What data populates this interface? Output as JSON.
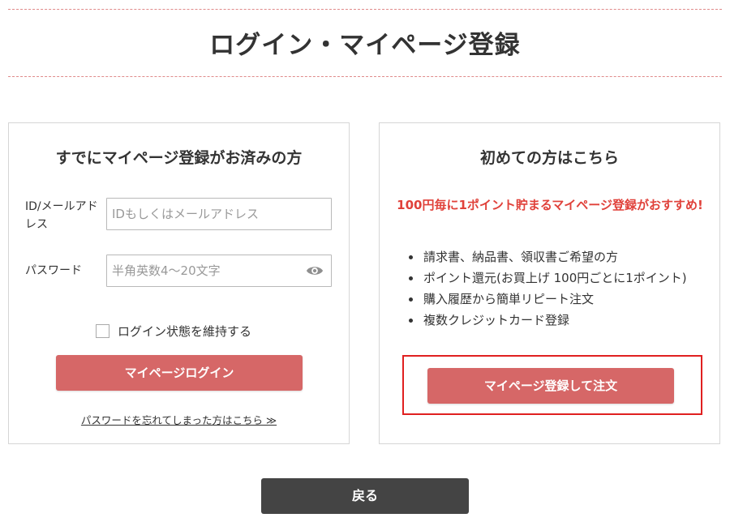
{
  "page": {
    "title": "ログイン・マイページ登録"
  },
  "login": {
    "heading": "すでにマイページ登録がお済みの方",
    "id_label": "ID/メールアドレス",
    "id_placeholder": "IDもしくはメールアドレス",
    "password_label": "パスワード",
    "password_placeholder": "半角英数4〜20文字",
    "password_icon": "eye-icon",
    "remember_label": "ログイン状態を維持する",
    "remember_checked": false,
    "login_button": "マイページログイン",
    "forgot_link": "パスワードを忘れてしまった方はこちら ≫"
  },
  "register": {
    "heading": "初めての方はこちら",
    "promo": "100円毎に1ポイント貯まるマイページ登録がおすすめ!",
    "benefits": [
      "請求書、納品書、領収書ご希望の方",
      "ポイント還元(お買上げ 100円ごとに1ポイント)",
      "購入履歴から簡単リピート注文",
      "複数クレジットカード登録"
    ],
    "register_button": "マイページ登録して注文"
  },
  "footer": {
    "back_button": "戻る"
  },
  "colors": {
    "accent_button": "#d66767",
    "promo_text": "#e0413a",
    "highlight_border": "#e02020",
    "back_button": "#444444",
    "divider": "#e08a8a"
  }
}
